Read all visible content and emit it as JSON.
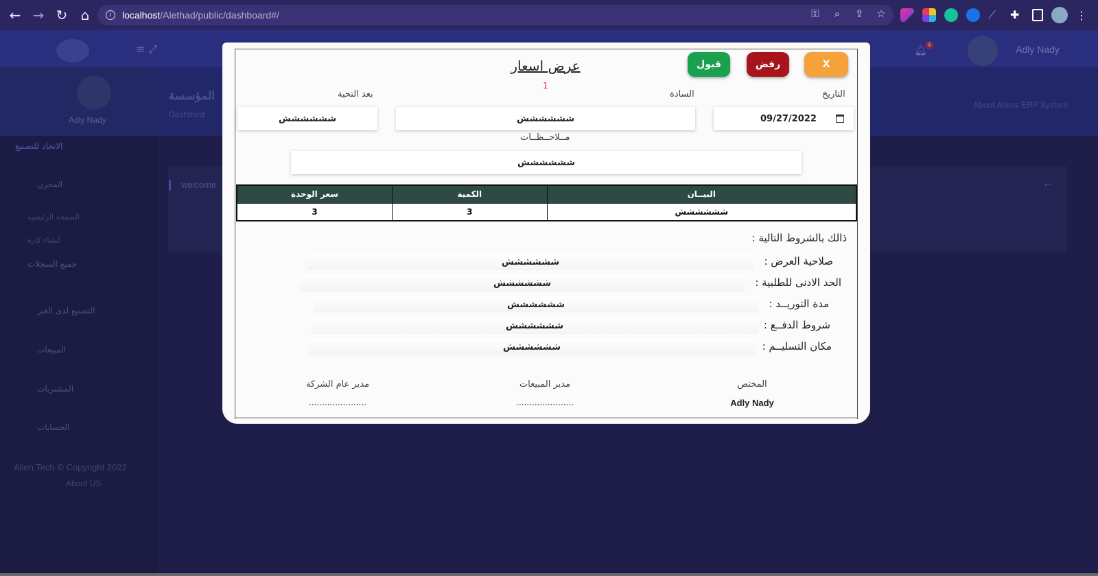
{
  "browser": {
    "url_host": "localhost",
    "url_path": "/Alethad/public/dashboard#/"
  },
  "header": {
    "user_name": "Adly Nady",
    "notification_count": "4"
  },
  "hero": {
    "title": "المؤسسة",
    "subtitle": "Dashbord",
    "about": "About Aliens ERP System"
  },
  "sidebar": {
    "user_name": "Adly Nady",
    "company": "الاتحاد للتصنيع",
    "items": [
      {
        "label": "المخزن"
      },
      {
        "label": "الصفحة الرئيسية"
      },
      {
        "label": "أنشاء كارة"
      },
      {
        "label": "جميع السجلات"
      },
      {
        "label": "التصنيع لدى الغير"
      },
      {
        "label": "المبيعات"
      },
      {
        "label": "المشتريات"
      },
      {
        "label": "الحسابات"
      }
    ],
    "footer": "Alien Tech © Copyright 2022",
    "about": "About US"
  },
  "content": {
    "welcome": "welcome"
  },
  "modal": {
    "title": "عرض اسعار",
    "number": "1",
    "buttons": {
      "accept": "قبول",
      "reject": "رفض",
      "close": "X"
    },
    "fields": {
      "date_label": "التاريخ",
      "date_value": "09/27/2022",
      "recipient_label": "السادة",
      "recipient_value": "شششششش",
      "greeting_label": "بعد التحية",
      "greeting_value": "شششششش",
      "notes_label": "مــلاحــظــات",
      "notes_value": "شششششش"
    },
    "table": {
      "headers": [
        "البيــان",
        "الكمية",
        "سعر الوحدة"
      ],
      "rows": [
        [
          "شششششش",
          "3",
          "3"
        ]
      ]
    },
    "terms": {
      "heading": "ذالك بالشروط التالية :",
      "items": [
        {
          "label": "صلاحية العرض :",
          "value": "شششششش"
        },
        {
          "label": "الحد الادنى للطلبية :",
          "value": "شششششش"
        },
        {
          "label": "مدة التوريــد :",
          "value": "شششششش"
        },
        {
          "label": "شروط الدفــع :",
          "value": "شششششش"
        },
        {
          "label": "مكان التسليــم :",
          "value": "شششششش"
        }
      ]
    },
    "signatures": {
      "specialist_label": "المختص",
      "specialist_value": "Adly Nady",
      "sales_manager_label": "مدير المبيعات",
      "sales_manager_value": "......................",
      "gm_label": "مدير عام الشركة",
      "gm_value": "......................"
    }
  }
}
